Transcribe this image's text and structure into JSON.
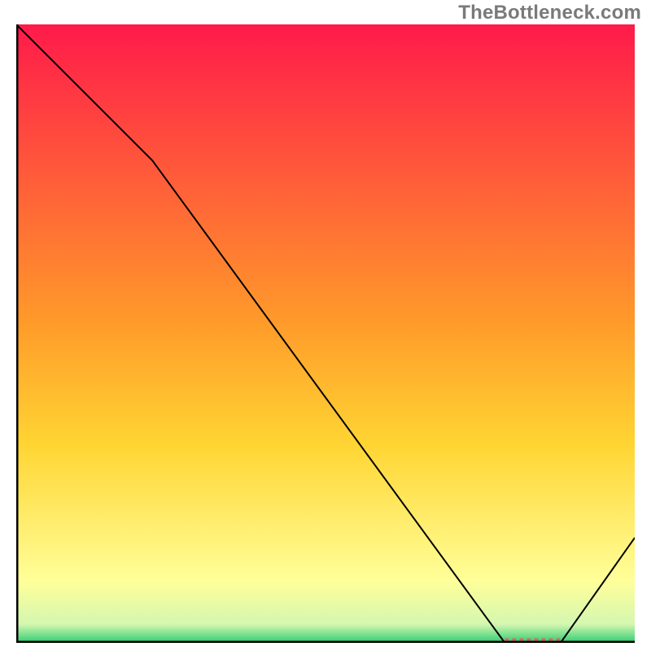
{
  "watermark": "TheBottleneck.com",
  "chart_data": {
    "type": "line",
    "title": "",
    "xlabel": "",
    "ylabel": "",
    "xlim": [
      0,
      100
    ],
    "ylim": [
      0,
      100
    ],
    "grid": false,
    "legend": false,
    "series": [
      {
        "name": "curve",
        "x": [
          0,
          22,
          79,
          88,
          100
        ],
        "y": [
          100,
          78,
          0,
          0,
          17
        ]
      }
    ],
    "annotations": [
      {
        "type": "marker-dashed",
        "x_start": 79,
        "x_end": 88,
        "y": 0,
        "color": "#e06060"
      }
    ],
    "background_gradient": {
      "top_color": "#ff1a4a",
      "mid_color": "#ffd533",
      "low_color": "#ffff99",
      "bottom_color": "#2ecc71"
    },
    "axis_color": "#000000",
    "axis_width": 5,
    "line_color": "#000000",
    "line_width": 2
  }
}
